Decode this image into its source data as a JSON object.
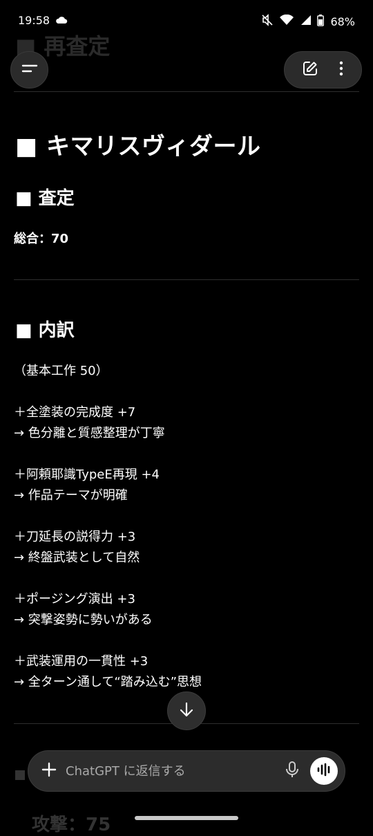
{
  "status_bar": {
    "time": "19:58",
    "battery": "68%",
    "icons": [
      "cloud-icon",
      "mute-icon",
      "wifi-icon",
      "signal-icon",
      "battery-icon"
    ]
  },
  "ghost_heading": "■ 再査定",
  "header": {
    "menu_icon": "menu-icon",
    "edit_icon": "edit-icon",
    "more_icon": "more-vertical-icon"
  },
  "content": {
    "title": "■ キマリスヴィダール",
    "assessment_heading": "■ 査定",
    "total": "総合：70",
    "breakdown_heading": "■ 内訳",
    "base": "（基本工作 50）",
    "items": [
      {
        "label": "＋全塗装の完成度 +7",
        "note": "→ 色分離と質感整理が丁寧"
      },
      {
        "label": "＋阿頼耶識TypeE再現 +4",
        "note": "→ 作品テーマが明確"
      },
      {
        "label": "＋刀延長の説得力 +3",
        "note": "→ 終盤武装として自然"
      },
      {
        "label": "＋ポージング演出 +3",
        "note": "→ 突撃姿勢に勢いがある"
      },
      {
        "label": "＋武装運用の一貫性 +3",
        "note": "→ 全ターン通して“踏み込む”思想"
      }
    ],
    "ghost_bottom": "攻撃：75"
  },
  "composer": {
    "placeholder": "ChatGPT に返信する"
  },
  "colors": {
    "background": "#000000",
    "surface": "#2c2c2c",
    "text": "#ffffff"
  }
}
